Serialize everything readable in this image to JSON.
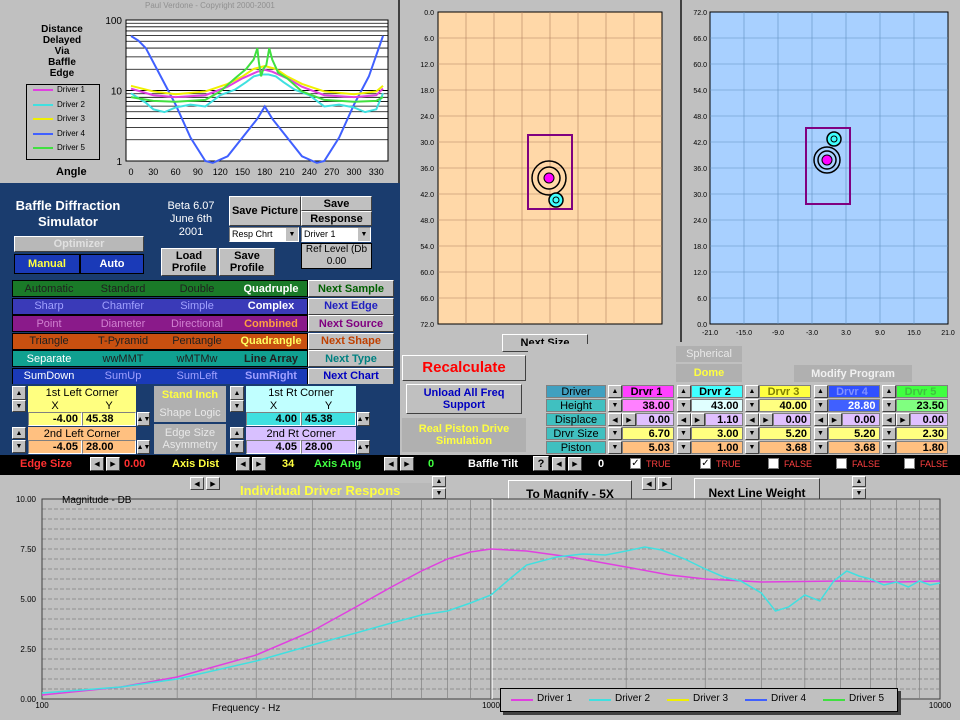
{
  "top_chart": {
    "title_lines": [
      "Distance",
      "Delayed",
      "Via",
      "Baffle",
      "Edge"
    ],
    "copyright": "Paul Verdone - Copyright 2000-2001",
    "y_ticks": [
      "100",
      "10",
      "1"
    ],
    "x_ticks": [
      "0",
      "30",
      "60",
      "90",
      "120",
      "150",
      "180",
      "210",
      "240",
      "270",
      "300",
      "330"
    ],
    "angle_label": "Angle",
    "legend": [
      {
        "name": "Driver 1",
        "color": "#e040e0"
      },
      {
        "name": "Driver 2",
        "color": "#40e0e0"
      },
      {
        "name": "Driver 3",
        "color": "#f0f000"
      },
      {
        "name": "Driver 4",
        "color": "#4060ff"
      },
      {
        "name": "Driver 5",
        "color": "#40e040"
      }
    ]
  },
  "front_view": {
    "x_ticks": [
      "0.0",
      "6.0",
      "12.0",
      "18.0",
      "24.0",
      "30.0",
      "36.0",
      "42.0",
      "48.0",
      "54.0",
      "60.0",
      "66.0",
      "72.0"
    ]
  },
  "side_view": {
    "y_ticks": [
      "72.0",
      "66.0",
      "60.0",
      "54.0",
      "48.0",
      "42.0",
      "36.0",
      "30.0",
      "24.0",
      "18.0",
      "12.0",
      "6.0",
      "0.0"
    ],
    "x_ticks": [
      "-21.0",
      "-15.0",
      "-9.0",
      "-3.0",
      "3.0",
      "9.0",
      "15.0",
      "21.0"
    ]
  },
  "app": {
    "title_line1": "Baffle Diffraction",
    "title_line2": "Simulator",
    "version": "Beta 6.07",
    "date_line1": "June 6th",
    "date_line2": "2001",
    "save_picture": "Save Picture",
    "save_response_1": "Save",
    "save_response_2": "Response",
    "resp_select": "Resp Chrt",
    "driver_select": "Driver 1",
    "ref_level_label": "Ref Level (Db",
    "ref_level_value": "0.00",
    "optimizer": "Optimizer",
    "manual": "Manual",
    "auto": "Auto",
    "load_profile": "Load Profile",
    "save_profile": "Save Profile"
  },
  "options": [
    {
      "bg": "#1a7a28",
      "items": [
        {
          "t": "Automatic",
          "c": "#202020"
        },
        {
          "t": "Standard",
          "c": "#202020"
        },
        {
          "t": "Double",
          "c": "#202020"
        },
        {
          "t": "Quadruple",
          "c": "#ffffff"
        }
      ],
      "btn": "Next Sample",
      "btn_color": "#006000"
    },
    {
      "bg": "#3a3ab8",
      "items": [
        {
          "t": "Sharp",
          "c": "#a0a0ff"
        },
        {
          "t": "Chamfer",
          "c": "#a0a0ff"
        },
        {
          "t": "Simple",
          "c": "#a0a0ff"
        },
        {
          "t": "Complex",
          "c": "#ffffff"
        }
      ],
      "btn": "Next Edge",
      "btn_color": "#2020c0"
    },
    {
      "bg": "#8a1a8a",
      "items": [
        {
          "t": "Point",
          "c": "#d080d0"
        },
        {
          "t": "Diameter",
          "c": "#d080d0"
        },
        {
          "t": "Directional",
          "c": "#d080d0"
        },
        {
          "t": "Combined",
          "c": "#ffa040"
        }
      ],
      "btn": "Next Source",
      "btn_color": "#800080"
    },
    {
      "bg": "#c85010",
      "items": [
        {
          "t": "Triangle",
          "c": "#202020"
        },
        {
          "t": "T-Pyramid",
          "c": "#202020"
        },
        {
          "t": "Pentangle",
          "c": "#202020"
        },
        {
          "t": "Quadrangle",
          "c": "#ffff60"
        }
      ],
      "btn": "Next Shape",
      "btn_color": "#c04000"
    },
    {
      "bg": "#10a090",
      "items": [
        {
          "t": "Separate",
          "c": "#ffffff"
        },
        {
          "t": "wwMMT",
          "c": "#202020"
        },
        {
          "t": "wMTMw",
          "c": "#202020"
        },
        {
          "t": "Line Array",
          "c": "#202020"
        }
      ],
      "btn": "Next Type",
      "btn_color": "#008080"
    },
    {
      "bg": "#1a3ab8",
      "items": [
        {
          "t": "SumDown",
          "c": "#ffffff"
        },
        {
          "t": "SumUp",
          "c": "#a0a0ff"
        },
        {
          "t": "SumLeft",
          "c": "#a0a0ff"
        },
        {
          "t": "SumRight",
          "c": "#a0a0ff"
        }
      ],
      "btn": "Next Chart",
      "btn_color": "#0000c0"
    }
  ],
  "corners": {
    "first_left": "1st Left Corner",
    "second_left": "2nd Left Corner",
    "first_right": "1st Rt Corner",
    "second_right": "2nd Rt Corner",
    "x": "X",
    "y": "Y",
    "fl_x": "-4.00",
    "fl_y": "45.38",
    "sl_x": "-4.05",
    "sl_y": "28.00",
    "fr_x": "4.00",
    "fr_y": "45.38",
    "sr_x": "4.05",
    "sr_y": "28.00",
    "stand_inch": "Stand Inch",
    "shape_logic": "Shape Logic",
    "edge_size_asym": "Edge Size Asymmetry"
  },
  "actions": {
    "recalculate": "Recalculate",
    "unload": "Unload All Freq Support",
    "real_piston": "Real Piston Drive Simulation",
    "next_size": "Next Size",
    "spherical": "Spherical",
    "dome": "Dome",
    "modify_program": "Modify Program"
  },
  "driver_table": {
    "row_labels": [
      "Driver",
      "Height",
      "Displace",
      "Drvr Size",
      "Piston"
    ],
    "drivers": [
      {
        "name": "Drvr 1",
        "bg": "#ff40ff",
        "fg": "#000000",
        "height": "38.00",
        "displace": "0.00",
        "size": "6.70",
        "piston": "5.03"
      },
      {
        "name": "Drvr 2",
        "bg": "#40ffff",
        "fg": "#000000",
        "height": "43.00",
        "displace": "1.10",
        "size": "3.00",
        "piston": "1.00"
      },
      {
        "name": "Drvr 3",
        "bg": "#ffff40",
        "fg": "#808000",
        "height": "40.00",
        "displace": "0.00",
        "size": "5.20",
        "piston": "3.68"
      },
      {
        "name": "Drvr 4",
        "bg": "#3050ff",
        "fg": "#8090ff",
        "height": "28.80",
        "displace": "0.00",
        "size": "5.20",
        "piston": "3.68"
      },
      {
        "name": "Drvr 5",
        "bg": "#40ff40",
        "fg": "#40c040",
        "height": "23.50",
        "displace": "0.00",
        "size": "2.30",
        "piston": "1.80"
      }
    ]
  },
  "status_bar": {
    "edge_size": "Edge Size",
    "edge_value": "0.00",
    "axis_dist": "Axis Dist",
    "axis_dist_value": "34",
    "axis_ang": "Axis Ang",
    "axis_ang_value": "0",
    "baffle_tilt": "Baffle Tilt",
    "question": "?",
    "tilt_value": "0",
    "checks": [
      {
        "label": "TRUE",
        "checked": true
      },
      {
        "label": "TRUE",
        "checked": true
      },
      {
        "label": "FALSE",
        "checked": false
      },
      {
        "label": "FALSE",
        "checked": false
      },
      {
        "label": "FALSE",
        "checked": false
      }
    ]
  },
  "bottom_chart": {
    "title": "Individual Driver Respons",
    "magnify": "To Magnify - 5X",
    "next_line_weight": "Next Line Weight",
    "y_label": "Magnitude  -  DB",
    "x_label": "Frequency  -  Hz",
    "y_ticks": [
      "10.00",
      "7.50",
      "5.00",
      "2.50",
      "0.00"
    ],
    "x_ticks": [
      "100",
      "1000",
      "10000"
    ],
    "legend": [
      {
        "name": "Driver 1",
        "color": "#e040e0"
      },
      {
        "name": "Driver 2",
        "color": "#40e0e0"
      },
      {
        "name": "Driver 3",
        "color": "#f0f000"
      },
      {
        "name": "Driver 4",
        "color": "#4060ff"
      },
      {
        "name": "Driver 5",
        "color": "#40e040"
      }
    ]
  }
}
